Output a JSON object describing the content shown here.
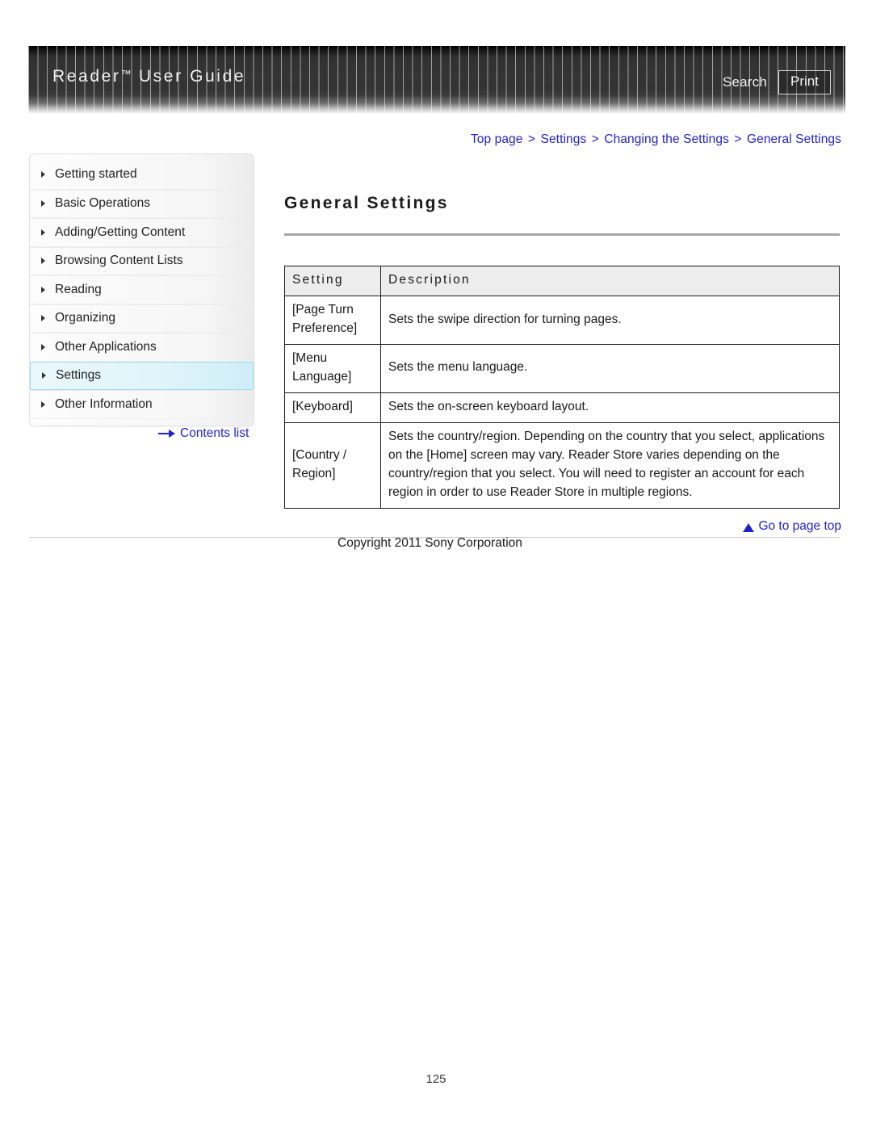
{
  "header": {
    "title": "Reader",
    "title_tm": "™",
    "title_rest": "User Guide",
    "search_label": "Search",
    "print_label": "Print"
  },
  "breadcrumb": {
    "separator": ">",
    "items": [
      {
        "label": "Top page"
      },
      {
        "label": "Settings"
      },
      {
        "label": "Changing the Settings"
      },
      {
        "label": "General Settings"
      }
    ]
  },
  "sidebar": {
    "items": [
      {
        "label": "Getting started",
        "active": false
      },
      {
        "label": "Basic Operations",
        "active": false
      },
      {
        "label": "Adding/Getting Content",
        "active": false
      },
      {
        "label": "Browsing Content Lists",
        "active": false
      },
      {
        "label": "Reading",
        "active": false
      },
      {
        "label": "Organizing",
        "active": false
      },
      {
        "label": "Other Applications",
        "active": false
      },
      {
        "label": "Settings",
        "active": true
      },
      {
        "label": "Other Information",
        "active": false
      }
    ],
    "contents_list_label": "Contents list"
  },
  "main": {
    "page_title": "General Settings",
    "table": {
      "headers": [
        "Setting",
        "Description"
      ],
      "rows": [
        {
          "setting": "[Page Turn Preference]",
          "description": "Sets the swipe direction for turning pages."
        },
        {
          "setting": "[Menu Language]",
          "description": "Sets the menu language."
        },
        {
          "setting": "[Keyboard]",
          "description": "Sets the on-screen keyboard layout."
        },
        {
          "setting": "[Country / Region]",
          "description": "Sets the country/region.\nDepending on the country that you select, applications on the [Home] screen may vary.\nReader Store varies depending on the country/region that you select. You will need to register an account for each region in order to use Reader Store in multiple regions."
        }
      ]
    }
  },
  "footer": {
    "go_to_top_label": "Go to page top",
    "copyright": "Copyright 2011 Sony Corporation",
    "page_number": "125"
  },
  "colors": {
    "link_blue": "#2222cc",
    "active_nav_bg": "#dff4fa",
    "active_nav_border": "#96dcec",
    "table_header_bg": "#ededed",
    "title_rule": "#a6a6a6"
  }
}
